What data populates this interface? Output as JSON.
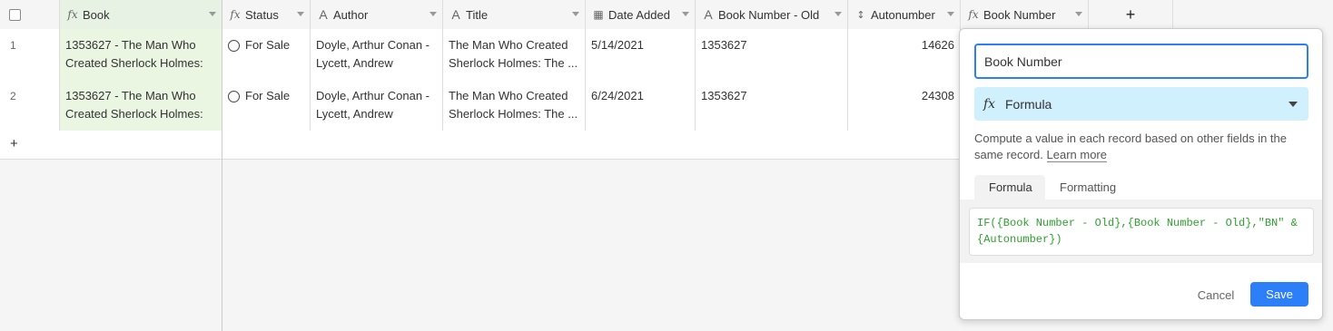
{
  "columns": [
    {
      "label": "Book",
      "icon": "formula-icon"
    },
    {
      "label": "Status",
      "icon": "formula-icon"
    },
    {
      "label": "Author",
      "icon": "text-icon"
    },
    {
      "label": "Title",
      "icon": "text-icon"
    },
    {
      "label": "Date Added",
      "icon": "calendar-icon"
    },
    {
      "label": "Book Number - Old",
      "icon": "text-icon"
    },
    {
      "label": "Autonumber",
      "icon": "autonumber-icon"
    },
    {
      "label": "Book Number",
      "icon": "formula-icon"
    }
  ],
  "add_column_label": "+",
  "rows": [
    {
      "num": "1",
      "book": "1353627 - The Man Who Created Sherlock Holmes: ...",
      "status": "For Sale",
      "author": "Doyle, Arthur Conan - Lycett, Andrew",
      "title": "The Man Who Created Sherlock Holmes: The ...",
      "date_added": "5/14/2021",
      "book_number_old": "1353627",
      "autonumber": "14626"
    },
    {
      "num": "2",
      "book": "1353627 - The Man Who Created Sherlock Holmes: ...",
      "status": "For Sale",
      "author": "Doyle, Arthur Conan - Lycett, Andrew",
      "title": "The Man Who Created Sherlock Holmes: The ...",
      "date_added": "6/24/2021",
      "book_number_old": "1353627",
      "autonumber": "24308"
    }
  ],
  "add_row_label": "+",
  "dialog": {
    "field_name": "Book Number",
    "field_type": "Formula",
    "description": "Compute a value in each record based on other fields in the same record.",
    "learn_more": "Learn more",
    "tabs": [
      "Formula",
      "Formatting"
    ],
    "formula": "IF({Book Number - Old},{Book Number - Old},\"BN\" & {Autonumber})",
    "cancel_label": "Cancel",
    "save_label": "Save"
  },
  "colors": {
    "accent": "#2d7ff9",
    "primary_column_bg": "#eaf5e2",
    "type_select_bg": "#d0f0fd",
    "formula_text": "#2fa02f"
  }
}
